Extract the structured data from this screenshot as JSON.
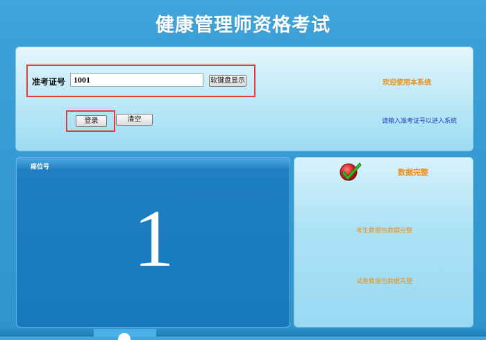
{
  "header": {
    "title": "健康管理师资格考试"
  },
  "login": {
    "id_label": "准考证号",
    "id_value": "1001",
    "keyboard_button": "软键盘显示",
    "login_button": "登录",
    "clear_button": "清空",
    "welcome": "欢迎使用本系统",
    "hint": "请输入准考证号以进入系统"
  },
  "seat": {
    "label": "座位号",
    "number": "1"
  },
  "status": {
    "title": "数据完整",
    "lines": [
      "考生数据包数据完整",
      "试卷数据包数据完整"
    ]
  },
  "colors": {
    "accent_orange": "#e8901a",
    "hint_blue": "#1d3fc0",
    "highlight_red": "#e03c3c",
    "seat_panel_blue": "#1679be"
  },
  "icons": {
    "status": "check-icon"
  }
}
